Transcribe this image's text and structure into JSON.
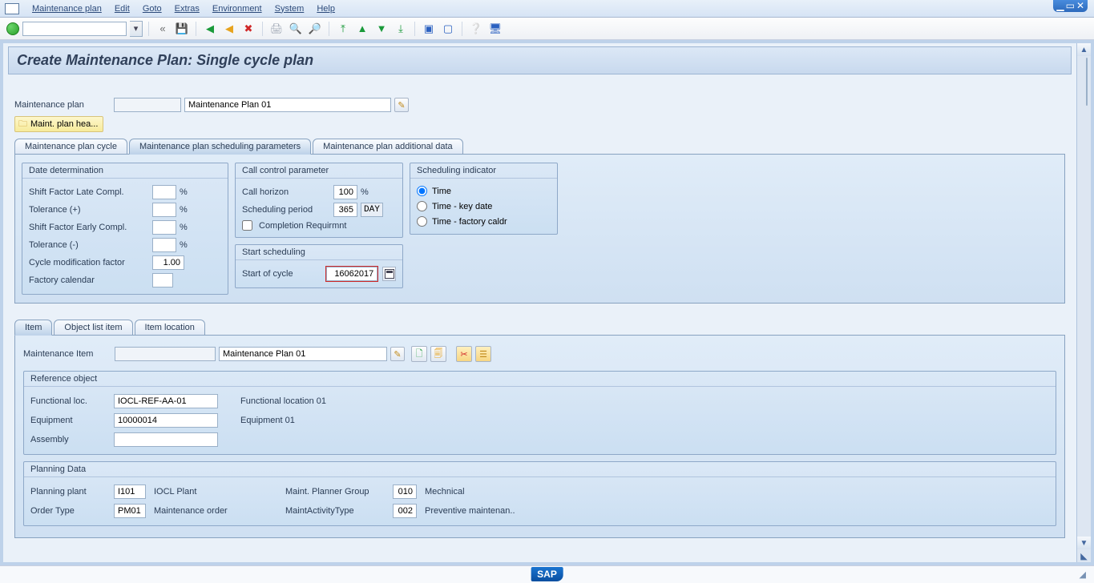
{
  "menu": {
    "items": [
      "Maintenance plan",
      "Edit",
      "Goto",
      "Extras",
      "Environment",
      "System",
      "Help"
    ]
  },
  "title": "Create Maintenance Plan: Single cycle plan",
  "maint_plan": {
    "label": "Maintenance plan",
    "id": "",
    "desc": "Maintenance Plan 01",
    "header_button": "Maint. plan hea..."
  },
  "main_tabs": [
    "Maintenance plan cycle",
    "Maintenance plan scheduling parameters",
    "Maintenance plan additional data"
  ],
  "main_tab_active": 1,
  "date_det": {
    "title": "Date determination",
    "shift_late_label": "Shift Factor Late Compl.",
    "shift_late": "",
    "tol_plus_label": "Tolerance (+)",
    "tol_plus": "",
    "shift_early_label": "Shift Factor Early Compl.",
    "shift_early": "",
    "tol_minus_label": "Tolerance (-)",
    "tol_minus": "",
    "cycle_mod_label": "Cycle modification factor",
    "cycle_mod": "1.00",
    "factory_cal_label": "Factory calendar",
    "factory_cal": "",
    "pct": "%"
  },
  "call_ctrl": {
    "title": "Call control parameter",
    "horizon_label": "Call horizon",
    "horizon": "100",
    "horizon_unit": "%",
    "sched_period_label": "Scheduling period",
    "sched_period": "365",
    "sched_unit": "DAY",
    "completion_label": "Completion Requirmnt",
    "completion": false
  },
  "sched_ind": {
    "title": "Scheduling indicator",
    "opts": [
      "Time",
      "Time - key date",
      "Time - factory caldr"
    ],
    "selected": 0
  },
  "start_sched": {
    "title": "Start scheduling",
    "start_label": "Start of cycle",
    "start_value": "16062017"
  },
  "item_tabs": [
    "Item",
    "Object list item",
    "Item location"
  ],
  "item_tab_active": 0,
  "maint_item": {
    "label": "Maintenance Item",
    "id": "",
    "desc": "Maintenance Plan 01"
  },
  "ref_obj": {
    "title": "Reference object",
    "floc_label": "Functional loc.",
    "floc": "IOCL-REF-AA-01",
    "floc_desc": "Functional location 01",
    "equip_label": "Equipment",
    "equip": "10000014",
    "equip_desc": "Equipment 01",
    "assembly_label": "Assembly",
    "assembly": ""
  },
  "plan_data": {
    "title": "Planning Data",
    "plant_label": "Planning plant",
    "plant": "I101",
    "plant_desc": "IOCL Plant",
    "pgroup_label": "Maint. Planner Group",
    "pgroup": "010",
    "pgroup_desc": "Mechnical",
    "otype_label": "Order Type",
    "otype": "PM01",
    "otype_desc": "Maintenance order",
    "acttype_label": "MaintActivityType",
    "acttype": "002",
    "acttype_desc": "Preventive maintenan.."
  },
  "footer_logo": "SAP"
}
